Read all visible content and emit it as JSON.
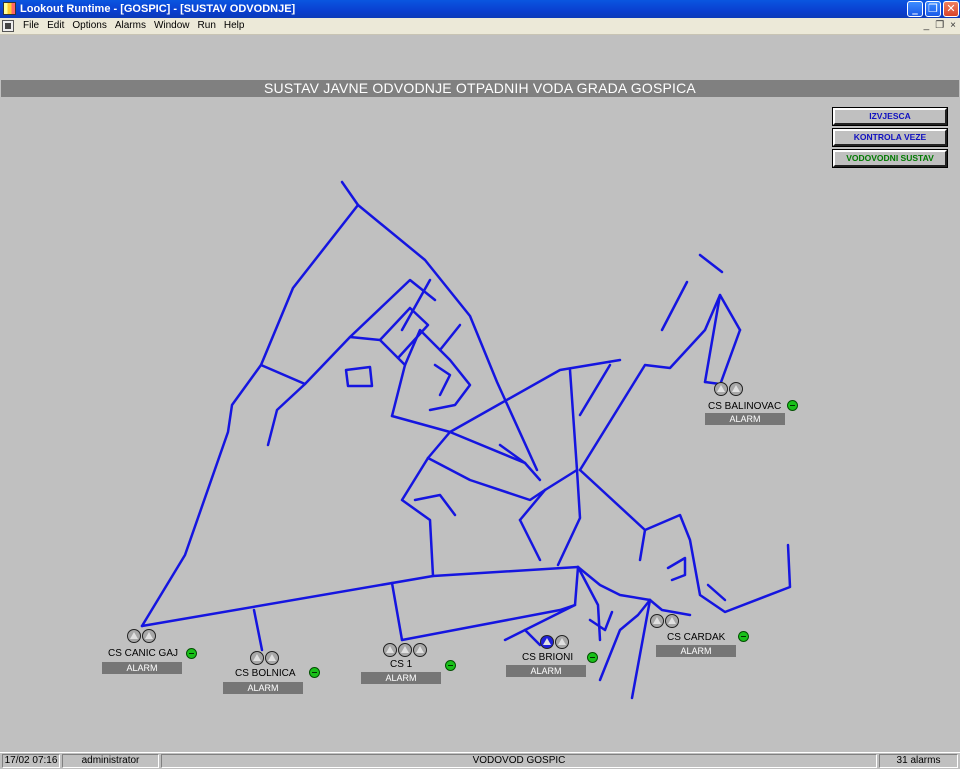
{
  "window": {
    "title": "Lookout Runtime - [GOSPIC] - [SUSTAV ODVODNJE]",
    "minimize": "_",
    "restore": "❐",
    "close": "✕"
  },
  "menu": {
    "items": [
      "File",
      "Edit",
      "Options",
      "Alarms",
      "Window",
      "Run",
      "Help"
    ],
    "mdi_min": "_",
    "mdi_restore": "❐",
    "mdi_close": "×"
  },
  "header": {
    "title": "SUSTAV JAVNE ODVODNJE OTPADNIH VODA GRADA GOSPICA"
  },
  "nav": {
    "reports": "IZVJESCA",
    "connection": "KONTROLA VEZE",
    "water_system": "VODOVODNI SUSTAV"
  },
  "stations": [
    {
      "name": "CS BALINOVAC",
      "alarm": "ALARM",
      "pumps": 2,
      "status": "ok"
    },
    {
      "name": "CS CANIC GAJ",
      "alarm": "ALARM",
      "pumps": 2,
      "status": "ok"
    },
    {
      "name": "CS BOLNICA",
      "alarm": "ALARM",
      "pumps": 2,
      "status": "ok"
    },
    {
      "name": "CS 1",
      "alarm": "ALARM",
      "pumps": 3,
      "status": "ok"
    },
    {
      "name": "CS BRIONI",
      "alarm": "ALARM",
      "pumps": 2,
      "status": "ok",
      "active_pump": 1
    },
    {
      "name": "CS CARDAK",
      "alarm": "ALARM",
      "pumps": 2,
      "status": "ok"
    }
  ],
  "statusbar": {
    "datetime": "17/02 07:16",
    "user": "administrator",
    "process": "VODOVOD GOSPIC",
    "alarms": "31 alarms"
  },
  "colors": {
    "pipe": "#1515e0",
    "status_ok": "#19c019",
    "alarm_bg": "#767676",
    "banner": "#808080"
  }
}
